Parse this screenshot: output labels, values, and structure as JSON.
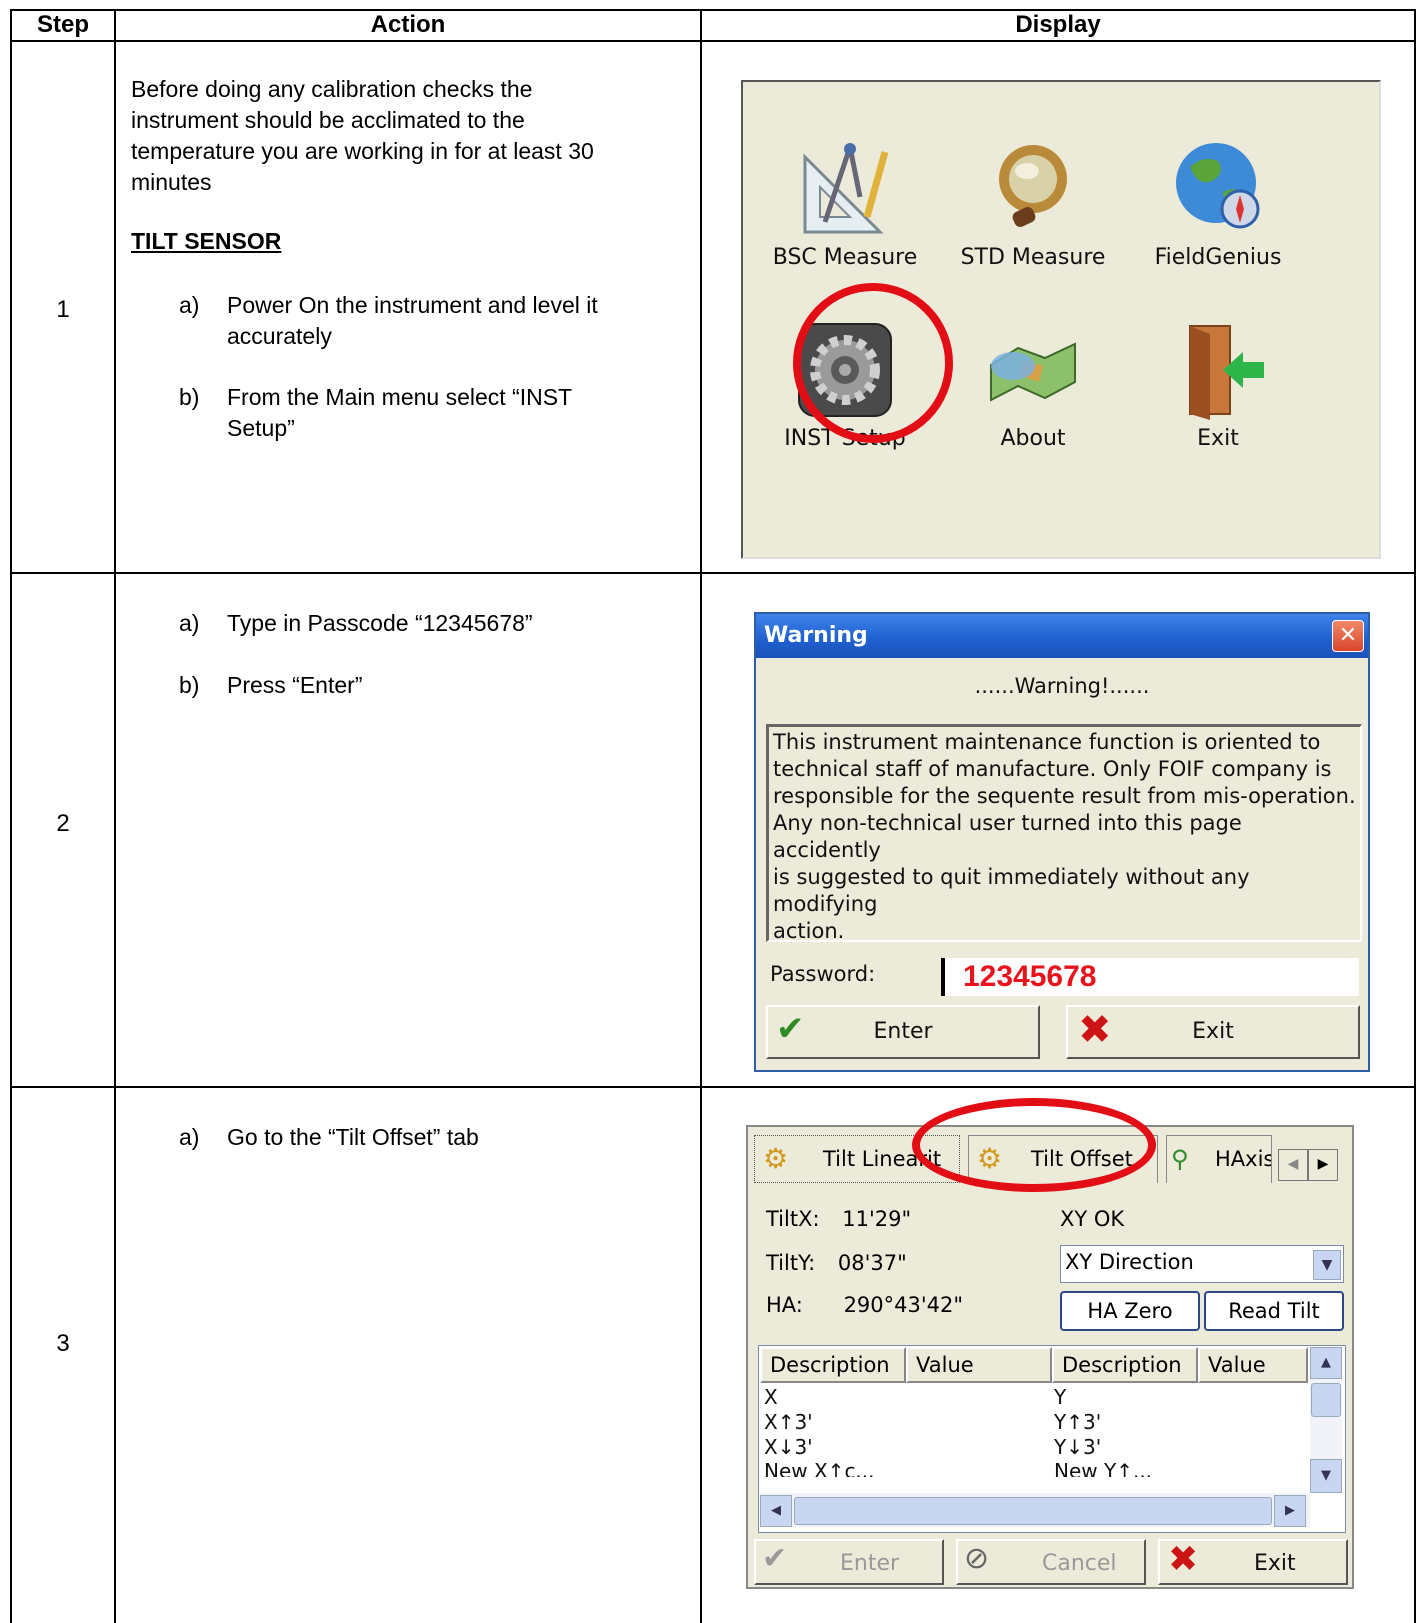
{
  "table": {
    "headers": [
      "Step",
      "Action",
      "Display"
    ],
    "rows": [
      {
        "step": "1",
        "intro": [
          "Before doing any calibration checks the",
          "instrument should be acclimated to the",
          "temperature you are working in for at least 30",
          "minutes"
        ],
        "section_heading": "TILT SENSOR",
        "items": [
          {
            "marker": "a)",
            "lines": [
              "Power On the instrument and level it",
              "accurately"
            ]
          },
          {
            "marker": "b)",
            "lines": [
              "From the Main menu select  “INST",
              "Setup”"
            ]
          }
        ]
      },
      {
        "step": "2",
        "items": [
          {
            "marker": "a)",
            "lines": [
              "Type in Passcode “12345678”"
            ]
          },
          {
            "marker": "b)",
            "lines": [
              "Press “Enter”"
            ]
          }
        ]
      },
      {
        "step": "3",
        "items": [
          {
            "marker": "a)",
            "lines": [
              "Go to the “Tilt Offset” tab"
            ]
          }
        ]
      }
    ]
  },
  "main_menu": {
    "apps": [
      "BSC Measure",
      "STD Measure",
      "FieldGenius",
      "INST Setup",
      "About",
      "Exit"
    ]
  },
  "warning_dialog": {
    "title": "Warning",
    "close_glyph": "✕",
    "heading": "......Warning!......",
    "message": [
      "This instrument maintenance function is oriented to",
      "technical staff of manufacture. Only FOIF company is",
      "responsible for the sequente result from mis-operation.",
      "Any non-technical user turned into this page accidently",
      "is suggested to quit immediately without any modifying",
      "action."
    ],
    "password_label": "Password:",
    "password_value": "12345678",
    "enter_label": "Enter",
    "exit_label": "Exit"
  },
  "tilt_screen": {
    "tabs": [
      "Tilt Linearit",
      "Tilt Offset",
      "HAxis E"
    ],
    "tilt_x_label": "TiltX:",
    "tilt_x_value": "11'29\"",
    "tilt_y_label": "TiltY:",
    "tilt_y_value": "08'37\"",
    "ha_label": "HA:",
    "ha_value": "290°43'42\"",
    "status": "XY OK",
    "direction": "XY Direction",
    "ha_zero_label": "HA Zero",
    "read_tilt_label": "Read Tilt",
    "columns": [
      "Description",
      "Value",
      "Description",
      "Value"
    ],
    "rows": [
      [
        "X",
        "Y"
      ],
      [
        "X↑3'",
        "Y↑3'"
      ],
      [
        "X↓3'",
        "Y↓3'"
      ],
      [
        "New X↑c...",
        "New Y↑..."
      ]
    ],
    "enter_label": "Enter",
    "cancel_label": "Cancel",
    "exit_label": "Exit"
  },
  "colors": {
    "highlight_ring": "#e30d16",
    "password_text": "#e8131c",
    "titlebar": "#1f5fd0"
  }
}
